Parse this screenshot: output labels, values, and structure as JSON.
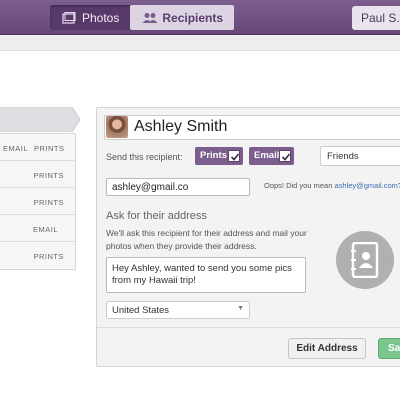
{
  "nav": {
    "tabs": [
      {
        "label": "Photos",
        "icon": "photos-icon"
      },
      {
        "label": "Recipients",
        "icon": "recipients-icon"
      }
    ],
    "user_label": "Paul S."
  },
  "left_list": {
    "rows": [
      {
        "email": "EMAIL",
        "prints": "PRINTS"
      },
      {
        "email": "",
        "prints": "PRINTS"
      },
      {
        "email": "",
        "prints": "PRINTS"
      },
      {
        "email": "EMAIL",
        "prints": ""
      },
      {
        "email": "",
        "prints": "PRINTS"
      }
    ]
  },
  "recipient": {
    "name": "Ashley Smith",
    "send_label": "Send this recipient:",
    "prints_label": "Prints",
    "prints_checked": true,
    "email_label": "Email",
    "email_checked": true,
    "group": "Friends",
    "email_value": "ashley@gmail.co",
    "oops_text": "Oops! Did you mean ",
    "oops_suggestion": "ashley@gmail.com",
    "oops_end": "?",
    "ask_heading": "Ask for their address",
    "ask_description": "We'll ask this recipient for their address and mail your photos when they provide their address.",
    "message": "Hey Ashley, wanted to send you some pics from my Hawaii trip!",
    "country": "United States",
    "edit_address_label": "Edit Address",
    "save_label": "Save"
  },
  "colors": {
    "nav_purple": "#6f5283",
    "chip_purple": "#7b5d8e",
    "save_green": "#7ac68e",
    "link_blue": "#3c6fb4"
  }
}
